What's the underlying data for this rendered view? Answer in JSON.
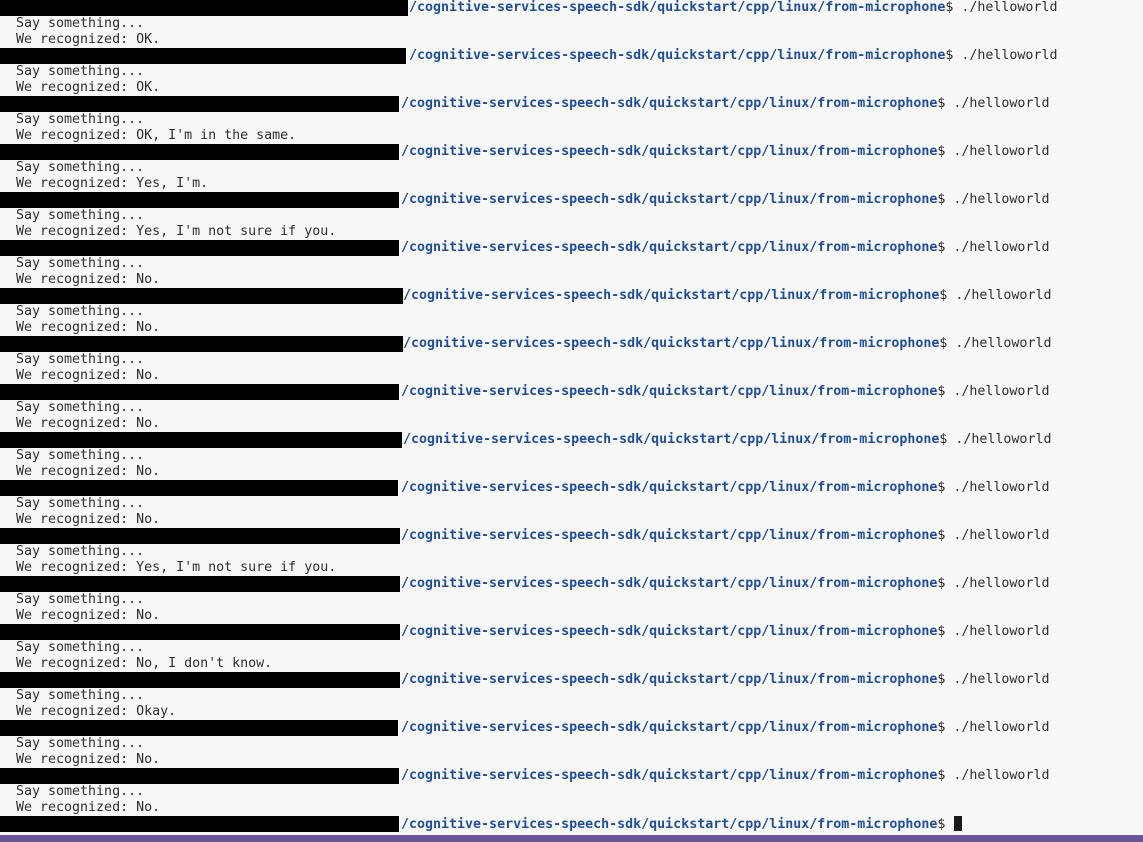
{
  "terminal": {
    "path": "/cognitive-services-speech-sdk/quickstart/cpp/linux/from-microphone",
    "dollar": "$ ",
    "command": "./helloworld",
    "runs": [
      {
        "say": "Say something...",
        "result": "We recognized: OK."
      },
      {
        "say": "Say something...",
        "result": "We recognized: OK."
      },
      {
        "say": "Say something...",
        "result": "We recognized: OK, I'm in the same."
      },
      {
        "say": "Say something...",
        "result": "We recognized: Yes, I'm."
      },
      {
        "say": "Say something...",
        "result": "We recognized: Yes, I'm not sure if you."
      },
      {
        "say": "Say something...",
        "result": "We recognized: No."
      },
      {
        "say": "Say something...",
        "result": "We recognized: No."
      },
      {
        "say": "Say something...",
        "result": "We recognized: No."
      },
      {
        "say": "Say something...",
        "result": "We recognized: No."
      },
      {
        "say": "Say something...",
        "result": "We recognized: No."
      },
      {
        "say": "Say something...",
        "result": "We recognized: No."
      },
      {
        "say": "Say something...",
        "result": "We recognized: Yes, I'm not sure if you."
      },
      {
        "say": "Say something...",
        "result": "We recognized: No."
      },
      {
        "say": "Say something...",
        "result": "We recognized: No, I don't know."
      },
      {
        "say": "Say something...",
        "result": "We recognized: Okay."
      },
      {
        "say": "Say something...",
        "result": "We recognized: No."
      },
      {
        "say": "Say something...",
        "result": "We recognized: No."
      }
    ]
  },
  "status_bar": {
    "color": "#6a5596"
  }
}
